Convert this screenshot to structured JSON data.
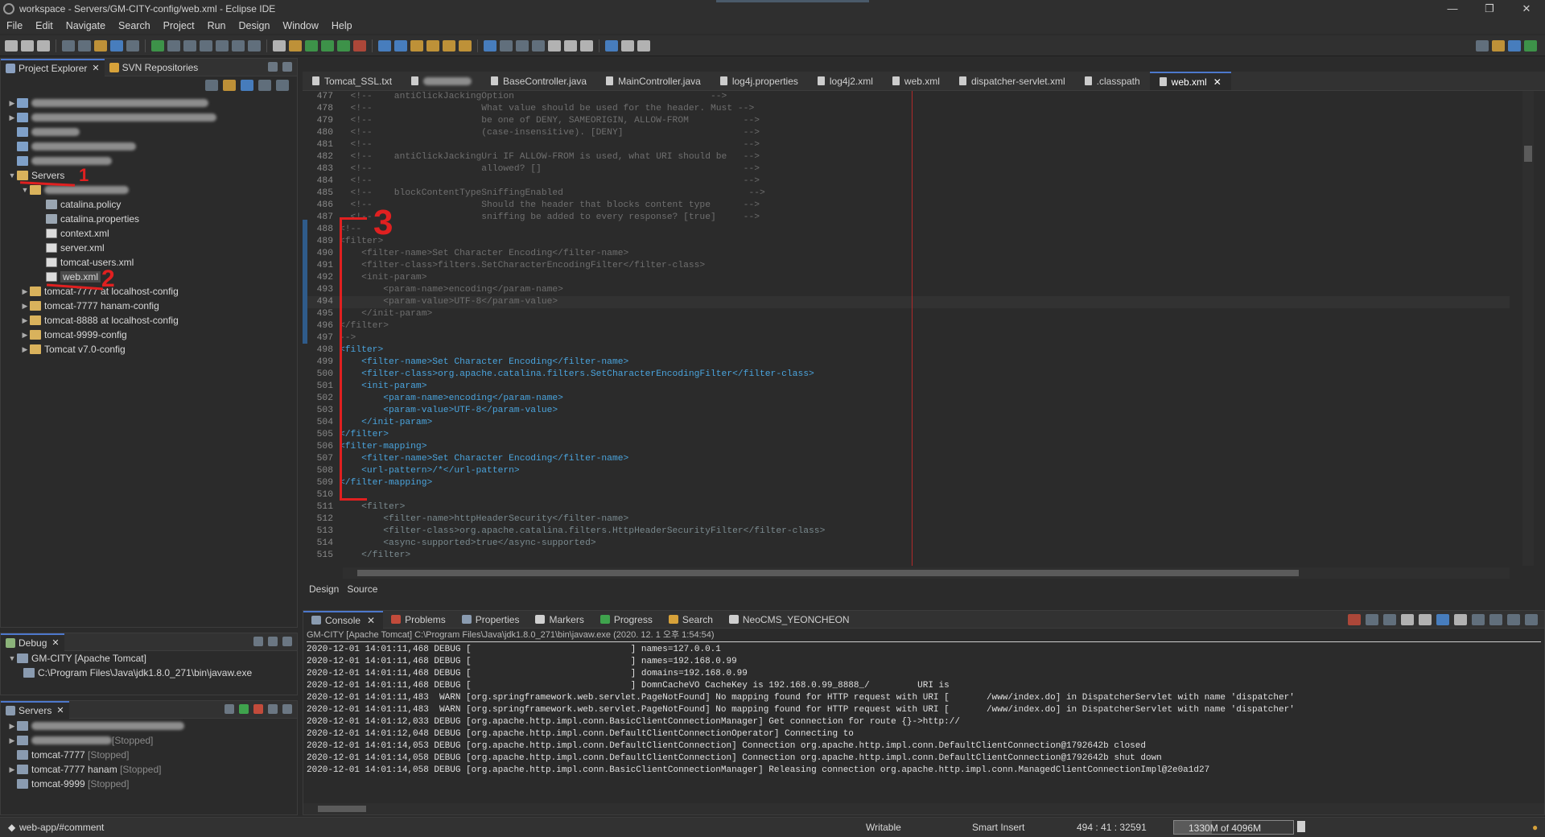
{
  "window": {
    "title": "workspace - Servers/GM-CITY-config/web.xml - Eclipse IDE",
    "controls": [
      "—",
      "❐",
      "✕"
    ]
  },
  "menu": [
    "File",
    "Edit",
    "Navigate",
    "Search",
    "Project",
    "Run",
    "Design",
    "Window",
    "Help"
  ],
  "project_explorer": {
    "tabs": [
      "Project Explorer",
      "SVN Repositories"
    ],
    "items": {
      "servers": "Servers",
      "catalina_policy": "catalina.policy",
      "catalina_properties": "catalina.properties",
      "context_xml": "context.xml",
      "server_xml": "server.xml",
      "tomcat_users": "tomcat-users.xml",
      "web_xml": "web.xml",
      "tomcat7777_local": "tomcat-7777 at localhost-config",
      "tomcat7777_config": "tomcat-7777 hanam-config",
      "tomcat8888_local": "tomcat-8888 at localhost-config",
      "tomcat9999": "tomcat-9999-config",
      "tomcat7": "Tomcat v7.0-config"
    }
  },
  "debug": {
    "tab": "Debug",
    "item1": "GM-CITY [Apache Tomcat]",
    "item2": "C:\\Program Files\\Java\\jdk1.8.0_271\\bin\\javaw.exe"
  },
  "servers_view": {
    "tab": "Servers",
    "items": [
      {
        "name": "",
        "state": ""
      },
      {
        "name": "",
        "state": "[Stopped]"
      },
      {
        "name": "tomcat-7777",
        "state": "[Stopped]"
      },
      {
        "name": "tomcat-7777 hanam",
        "state": "[Stopped]"
      },
      {
        "name": "tomcat-9999",
        "state": "[Stopped]"
      }
    ]
  },
  "editor": {
    "tabs": [
      "Tomcat_SSL.txt",
      "",
      "BaseController.java",
      "MainController.java",
      "log4j.properties",
      "log4j2.xml",
      "web.xml",
      "dispatcher-servlet.xml",
      ".classpath",
      "web.xml"
    ],
    "bottom_tabs": [
      "Design",
      "Source"
    ],
    "lines": [
      {
        "n": "477",
        "c": "  <!--    antiClickJackingOption                                    -->"
      },
      {
        "n": "478",
        "c": "  <!--                    What value should be used for the header. Must -->"
      },
      {
        "n": "479",
        "c": "  <!--                    be one of DENY, SAMEORIGIN, ALLOW-FROM          -->"
      },
      {
        "n": "480",
        "c": "  <!--                    (case-insensitive). [DENY]                      -->"
      },
      {
        "n": "481",
        "c": "  <!--                                                                    -->"
      },
      {
        "n": "482",
        "c": "  <!--    antiClickJackingUri IF ALLOW-FROM is used, what URI should be   -->"
      },
      {
        "n": "483",
        "c": "  <!--                    allowed? []                                     -->"
      },
      {
        "n": "484",
        "c": "  <!--                                                                    -->"
      },
      {
        "n": "485",
        "c": "  <!--    blockContentTypeSniffingEnabled                                  -->"
      },
      {
        "n": "486",
        "c": "  <!--                    Should the header that blocks content type      -->"
      },
      {
        "n": "487",
        "c": "  <!--                    sniffing be added to every response? [true]     -->"
      },
      {
        "n": "488",
        "c": "<!--"
      },
      {
        "n": "489",
        "c": "<filter>"
      },
      {
        "n": "490",
        "c": "    <filter-name>Set Character Encoding</filter-name>"
      },
      {
        "n": "491",
        "c": "    <filter-class>filters.SetCharacterEncodingFilter</filter-class>"
      },
      {
        "n": "492",
        "c": "    <init-param>"
      },
      {
        "n": "493",
        "c": "        <param-name>encoding</param-name>"
      },
      {
        "n": "494",
        "c": "        <param-value>UTF-8</param-value>"
      },
      {
        "n": "495",
        "c": "    </init-param>"
      },
      {
        "n": "496",
        "c": "</filter>"
      },
      {
        "n": "497",
        "c": "-->"
      },
      {
        "n": "498",
        "c": "<filter>"
      },
      {
        "n": "499",
        "c": "    <filter-name>Set Character Encoding</filter-name>"
      },
      {
        "n": "500",
        "c": "    <filter-class>org.apache.catalina.filters.SetCharacterEncodingFilter</filter-class>"
      },
      {
        "n": "501",
        "c": "    <init-param>"
      },
      {
        "n": "502",
        "c": "        <param-name>encoding</param-name>"
      },
      {
        "n": "503",
        "c": "        <param-value>UTF-8</param-value>"
      },
      {
        "n": "504",
        "c": "    </init-param>"
      },
      {
        "n": "505",
        "c": "</filter>"
      },
      {
        "n": "506",
        "c": "<filter-mapping>"
      },
      {
        "n": "507",
        "c": "    <filter-name>Set Character Encoding</filter-name>"
      },
      {
        "n": "508",
        "c": "    <url-pattern>/*</url-pattern>"
      },
      {
        "n": "509",
        "c": "</filter-mapping>"
      },
      {
        "n": "510",
        "c": ""
      },
      {
        "n": "511",
        "c": "    <filter>"
      },
      {
        "n": "512",
        "c": "        <filter-name>httpHeaderSecurity</filter-name>"
      },
      {
        "n": "513",
        "c": "        <filter-class>org.apache.catalina.filters.HttpHeaderSecurityFilter</filter-class>"
      },
      {
        "n": "514",
        "c": "        <async-supported>true</async-supported>"
      },
      {
        "n": "515",
        "c": "    </filter>"
      }
    ]
  },
  "console": {
    "tabs": [
      "Console",
      "Problems",
      "Properties",
      "Markers",
      "Progress",
      "Search",
      "NeoCMS_YEONCHEON"
    ],
    "header": "GM-CITY [Apache Tomcat] C:\\Program Files\\Java\\jdk1.8.0_271\\bin\\javaw.exe  (2020. 12. 1 오후 1:54:54)",
    "lines": [
      "2020-12-01 14:01:11,468 DEBUG [                              ] names=127.0.0.1",
      "2020-12-01 14:01:11,468 DEBUG [                              ] names=192.168.0.99",
      "2020-12-01 14:01:11,468 DEBUG [                              ] domains=192.168.0.99",
      "2020-12-01 14:01:11,468 DEBUG [                              ] DomnCacheVO CacheKey is 192.168.0.99_8888_/         URI is",
      "2020-12-01 14:01:11,483  WARN [org.springframework.web.servlet.PageNotFound] No mapping found for HTTP request with URI [       /www/index.do] in DispatcherServlet with name 'dispatcher'",
      "2020-12-01 14:01:11,483  WARN [org.springframework.web.servlet.PageNotFound] No mapping found for HTTP request with URI [       /www/index.do] in DispatcherServlet with name 'dispatcher'",
      "2020-12-01 14:01:12,033 DEBUG [org.apache.http.impl.conn.BasicClientConnectionManager] Get connection for route {}->http://",
      "2020-12-01 14:01:12,048 DEBUG [org.apache.http.impl.conn.DefaultClientConnectionOperator] Connecting to",
      "2020-12-01 14:01:14,053 DEBUG [org.apache.http.impl.conn.DefaultClientConnection] Connection org.apache.http.impl.conn.DefaultClientConnection@1792642b closed",
      "2020-12-01 14:01:14,058 DEBUG [org.apache.http.impl.conn.DefaultClientConnection] Connection org.apache.http.impl.conn.DefaultClientConnection@1792642b shut down",
      "2020-12-01 14:01:14,058 DEBUG [org.apache.http.impl.conn.BasicClientConnectionManager] Releasing connection org.apache.http.impl.conn.ManagedClientConnectionImpl@2e0a1d27"
    ]
  },
  "status": {
    "path": "web-app/#comment",
    "mode": "Writable",
    "insert": "Smart Insert",
    "position": "494 : 41 : 32591",
    "heap": "1330M of 4096M",
    "heap_used": 0.32
  },
  "annotations": [
    "1",
    "2",
    "3"
  ],
  "colors": {
    "accent": "#4d78cc",
    "annotation": "#e02020",
    "ruler": "#b02a2a"
  }
}
